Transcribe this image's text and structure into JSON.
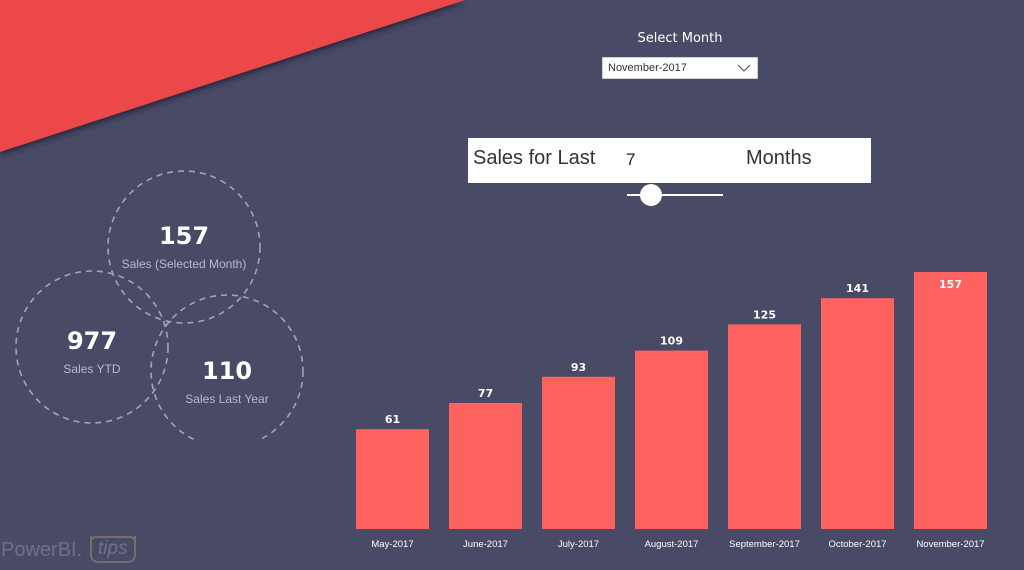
{
  "colors": {
    "background": "#484a66",
    "banner": "#ec4749",
    "bar": "#fd625e",
    "text": "#ffffff",
    "muted_text": "#b9bac8"
  },
  "month_slicer": {
    "title": "Select Month",
    "selected": "November-2017",
    "icon": "chevron-down-icon"
  },
  "months_card": {
    "label_prefix": "Sales for Last",
    "value": "7",
    "label_suffix": "Months",
    "slider_fraction": 0.25
  },
  "kpis": [
    {
      "value": "157",
      "label": "Sales (Selected Month)"
    },
    {
      "value": "977",
      "label": "Sales YTD"
    },
    {
      "value": "110",
      "label": "Sales Last Year"
    }
  ],
  "logo": {
    "main": "PowerBI.",
    "sub": "tips"
  },
  "chart_data": {
    "type": "bar",
    "title": "",
    "xlabel": "",
    "ylabel": "",
    "categories": [
      "May-2017",
      "June-2017",
      "July-2017",
      "August-2017",
      "September-2017",
      "October-2017",
      "November-2017"
    ],
    "values": [
      61,
      77,
      93,
      109,
      125,
      141,
      157
    ],
    "data_labels": [
      "61",
      "77",
      "93",
      "109",
      "125",
      "141",
      "157"
    ],
    "ylim": [
      0,
      157
    ],
    "grid": false,
    "legend": "none"
  }
}
